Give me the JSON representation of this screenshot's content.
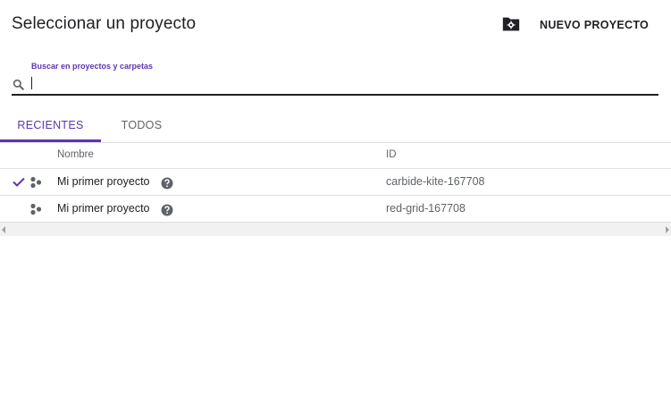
{
  "dialog": {
    "title": "Seleccionar un proyecto",
    "new_project_label": "NUEVO PROYECTO",
    "new_project_icon": "folder-settings-icon"
  },
  "search": {
    "label": "Buscar en proyectos y carpetas",
    "value": "",
    "icon": "search-icon"
  },
  "tabs": [
    {
      "label": "RECIENTES",
      "active": true
    },
    {
      "label": "TODOS",
      "active": false
    }
  ],
  "table": {
    "columns": [
      "Nombre",
      "ID"
    ],
    "rows": [
      {
        "name": "Mi primer proyecto",
        "id": "carbide-kite-167708",
        "selected": true
      },
      {
        "name": "Mi primer proyecto",
        "id": "red-grid-167708",
        "selected": false
      }
    ]
  },
  "colors": {
    "accent": "#5e35b1",
    "text": "#202124",
    "secondary_text": "#5f6368",
    "divider": "#e0e0e0"
  }
}
